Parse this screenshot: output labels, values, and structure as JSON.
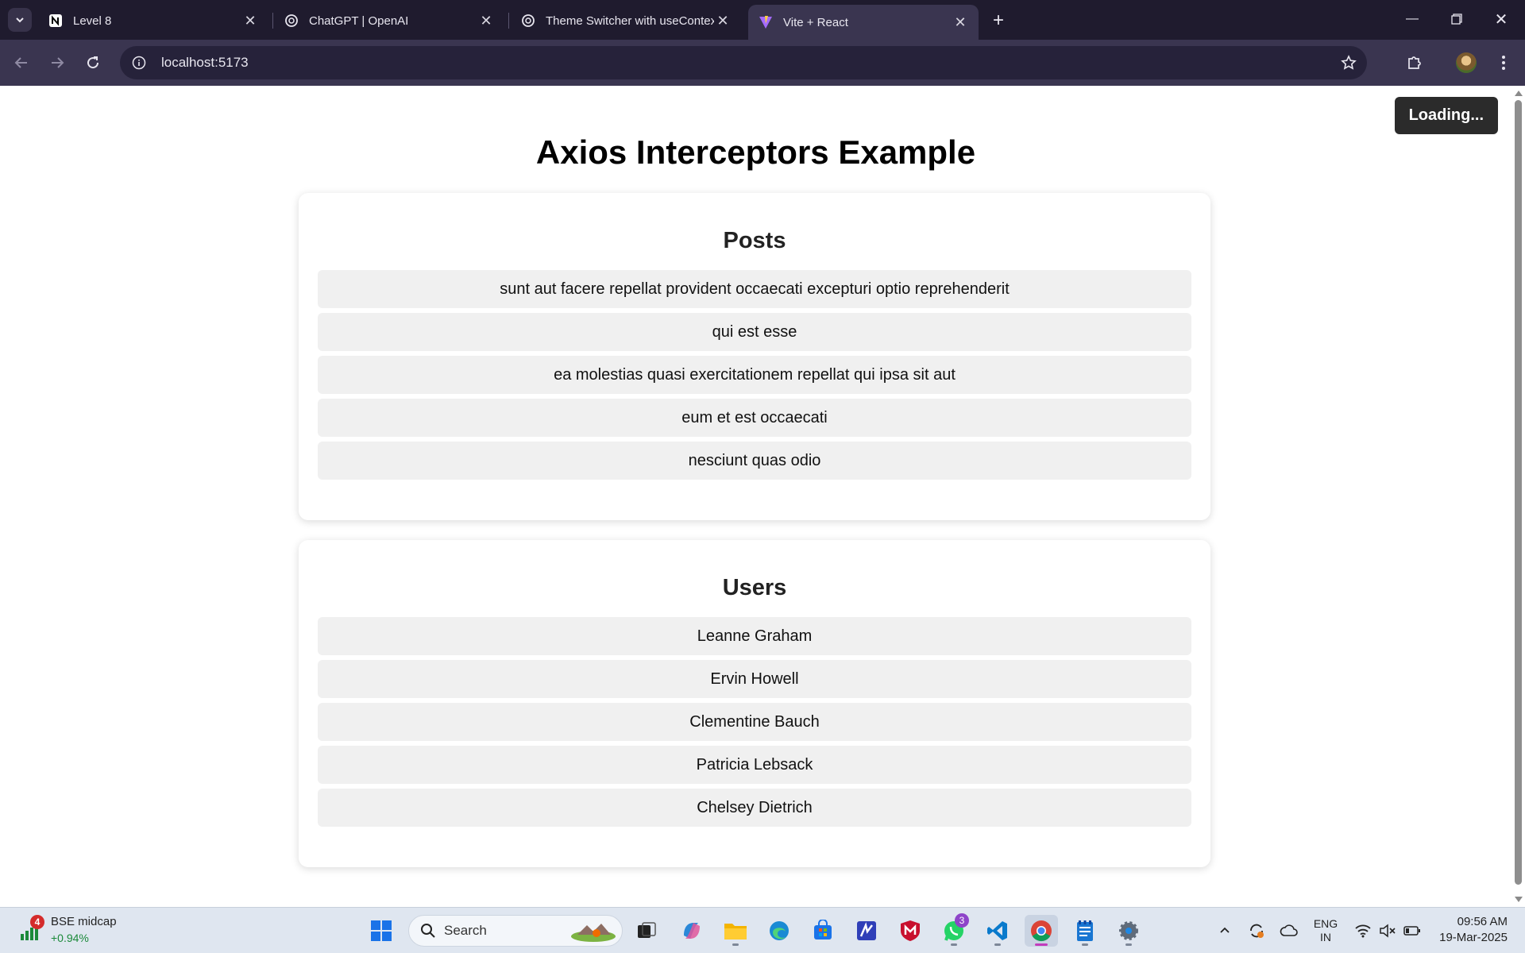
{
  "browser": {
    "tabs": [
      {
        "title": "Level 8",
        "icon": "notion-icon",
        "active": false
      },
      {
        "title": "ChatGPT | OpenAI",
        "icon": "openai-icon",
        "active": false
      },
      {
        "title": "Theme Switcher with useContext",
        "icon": "openai-icon",
        "active": false
      },
      {
        "title": "Vite + React",
        "icon": "vite-icon",
        "active": true
      }
    ],
    "url": "localhost:5173"
  },
  "page": {
    "loading_label": "Loading...",
    "title": "Axios Interceptors Example",
    "posts": {
      "heading": "Posts",
      "items": [
        "sunt aut facere repellat provident occaecati excepturi optio reprehenderit",
        "qui est esse",
        "ea molestias quasi exercitationem repellat qui ipsa sit aut",
        "eum et est occaecati",
        "nesciunt quas odio"
      ]
    },
    "users": {
      "heading": "Users",
      "items": [
        "Leanne Graham",
        "Ervin Howell",
        "Clementine Bauch",
        "Patricia Lebsack",
        "Chelsey Dietrich"
      ]
    }
  },
  "taskbar": {
    "widget": {
      "badge": "4",
      "name": "BSE midcap",
      "change": "+0.94%"
    },
    "search_label": "Search",
    "whatsapp_badge": "3",
    "language": {
      "line1": "ENG",
      "line2": "IN"
    },
    "clock": {
      "time": "09:56 AM",
      "date": "19-Mar-2025"
    }
  },
  "colors": {
    "tab_strip": "#1f1b2e",
    "toolbar": "#3a3550",
    "page_bg": "#ffffff",
    "list_item_bg": "#f0f0f0",
    "loading_bg": "#2b2b2b",
    "taskbar": "#dfe6f0",
    "stock_up": "#1b8a3a"
  }
}
